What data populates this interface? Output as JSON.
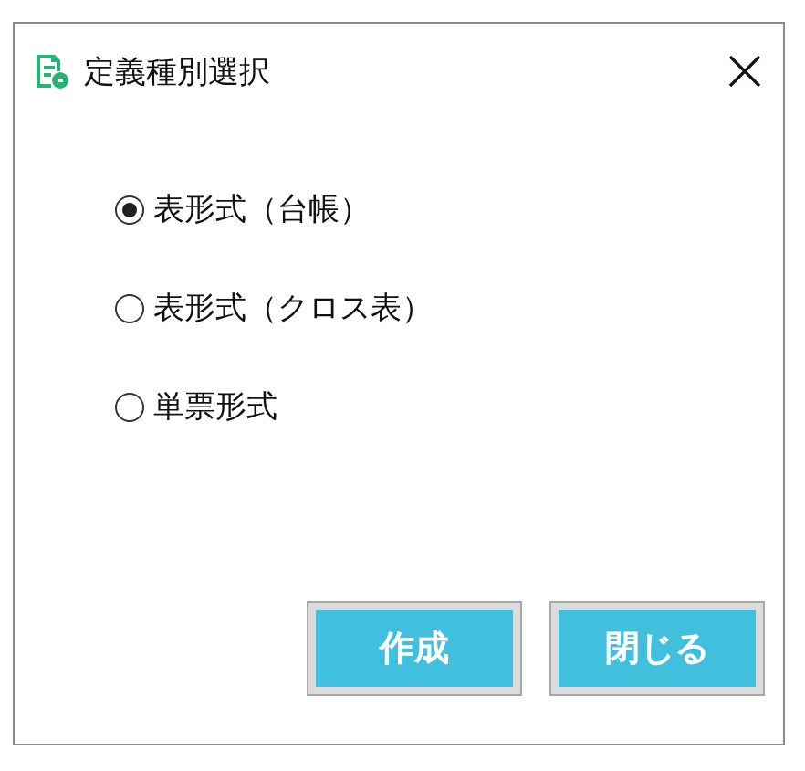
{
  "window": {
    "title": "定義種別選択"
  },
  "options": [
    {
      "label": "表形式（台帳）",
      "selected": true
    },
    {
      "label": "表形式（クロス表）",
      "selected": false
    },
    {
      "label": "単票形式",
      "selected": false
    }
  ],
  "buttons": [
    "作成",
    "閉じる"
  ]
}
